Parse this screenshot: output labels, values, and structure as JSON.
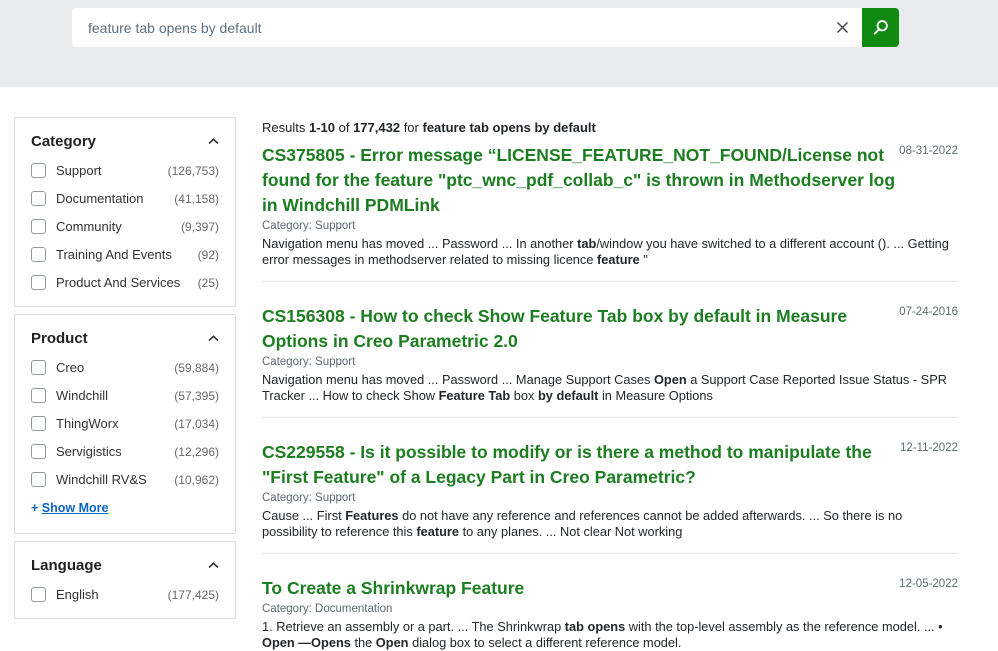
{
  "colors": {
    "header_background": "#e8eaec",
    "button_green": "#108910",
    "title_green": "#1c7d21",
    "link_blue": "#0b63c4"
  },
  "icons": {
    "search": "magnifier-icon",
    "clear": "x-mark-icon",
    "collapse": "chevron-up-icon",
    "checkbox": "empty-checkbox"
  },
  "search": {
    "value": "feature tab opens by default"
  },
  "sidebar": {
    "sections": [
      {
        "title": "Category",
        "items": [
          {
            "label": "Support",
            "count": "(126,753)"
          },
          {
            "label": "Documentation",
            "count": "(41,158)"
          },
          {
            "label": "Community",
            "count": "(9,397)"
          },
          {
            "label": "Training And Events",
            "count": "(92)"
          },
          {
            "label": "Product And Services",
            "count": "(25)"
          }
        ]
      },
      {
        "title": "Product",
        "items": [
          {
            "label": "Creo",
            "count": "(59,884)"
          },
          {
            "label": "Windchill",
            "count": "(57,395)"
          },
          {
            "label": "ThingWorx",
            "count": "(17,034)"
          },
          {
            "label": "Servigistics",
            "count": "(12,296)"
          },
          {
            "label": "Windchill RV&S",
            "count": "(10,962)"
          }
        ],
        "show_more_prefix": "+ ",
        "show_more": "Show More"
      },
      {
        "title": "Language",
        "items": [
          {
            "label": "English",
            "count": "(177,425)"
          }
        ]
      }
    ]
  },
  "results_header": [
    {
      "t": "Results ",
      "b": false
    },
    {
      "t": "1-10",
      "b": true
    },
    {
      "t": " of ",
      "b": false
    },
    {
      "t": "177,432",
      "b": true
    },
    {
      "t": " for ",
      "b": false
    },
    {
      "t": "feature tab opens by default",
      "b": true
    }
  ],
  "results": [
    {
      "title": "CS375805 - Error message “LICENSE_FEATURE_NOT_FOUND/License not found for the feature \"ptc_wnc_pdf_collab_c\" is thrown in Methodserver log in Windchill PDMLink",
      "date": "08-31-2022",
      "category": "Category: Support",
      "snippet": [
        {
          "t": "Navigation menu has moved ... Password ... In another ",
          "b": false
        },
        {
          "t": "tab",
          "b": true
        },
        {
          "t": "/window you have switched to a different account (). ... Getting error messages in methodserver related to missing licence ",
          "b": false
        },
        {
          "t": "feature",
          "b": true
        },
        {
          "t": " \"",
          "b": false
        }
      ]
    },
    {
      "title": "CS156308 - How to check Show Feature Tab box by default in Measure Options in Creo Parametric 2.0",
      "date": "07-24-2016",
      "category": "Category: Support",
      "snippet": [
        {
          "t": "Navigation menu has moved ... Password ... Manage Support Cases ",
          "b": false
        },
        {
          "t": "Open",
          "b": true
        },
        {
          "t": " a Support Case Reported Issue Status - SPR Tracker ... How to check Show ",
          "b": false
        },
        {
          "t": "Feature Tab",
          "b": true
        },
        {
          "t": " box ",
          "b": false
        },
        {
          "t": "by default",
          "b": true
        },
        {
          "t": " in Measure Options",
          "b": false
        }
      ]
    },
    {
      "title": "CS229558 - Is it possible to modify or is there a method to manipulate the \"First Feature\" of a Legacy Part in Creo Parametric?",
      "date": "12-11-2022",
      "category": "Category: Support",
      "snippet": [
        {
          "t": "Cause ... First ",
          "b": false
        },
        {
          "t": "Features",
          "b": true
        },
        {
          "t": " do not have any reference and references cannot be added afterwards. ... So there is no possibility to reference this ",
          "b": false
        },
        {
          "t": "feature",
          "b": true
        },
        {
          "t": " to any planes. ... Not clear Not working",
          "b": false
        }
      ]
    },
    {
      "title": "To Create a Shrinkwrap Feature",
      "date": "12-05-2022",
      "category": "Category: Documentation",
      "snippet": [
        {
          "t": "1. Retrieve an assembly or a part. ... The Shrinkwrap ",
          "b": false
        },
        {
          "t": "tab opens",
          "b": true
        },
        {
          "t": " with the top-level assembly as the reference model. ... • ",
          "b": false
        },
        {
          "t": "Open —Opens",
          "b": true
        },
        {
          "t": " the ",
          "b": false
        },
        {
          "t": "Open",
          "b": true
        },
        {
          "t": " dialog box to select a different reference model.",
          "b": false
        }
      ]
    }
  ]
}
